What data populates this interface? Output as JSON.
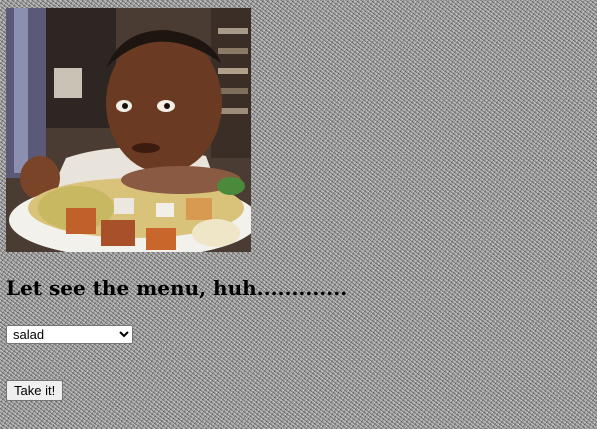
{
  "page": {
    "heading": "Let see the menu, huh............."
  },
  "menu": {
    "selected": "salad",
    "options": [
      "salad"
    ]
  },
  "actions": {
    "submit_label": "Take it!"
  },
  "image": {
    "subject": "man holding plate of food"
  }
}
